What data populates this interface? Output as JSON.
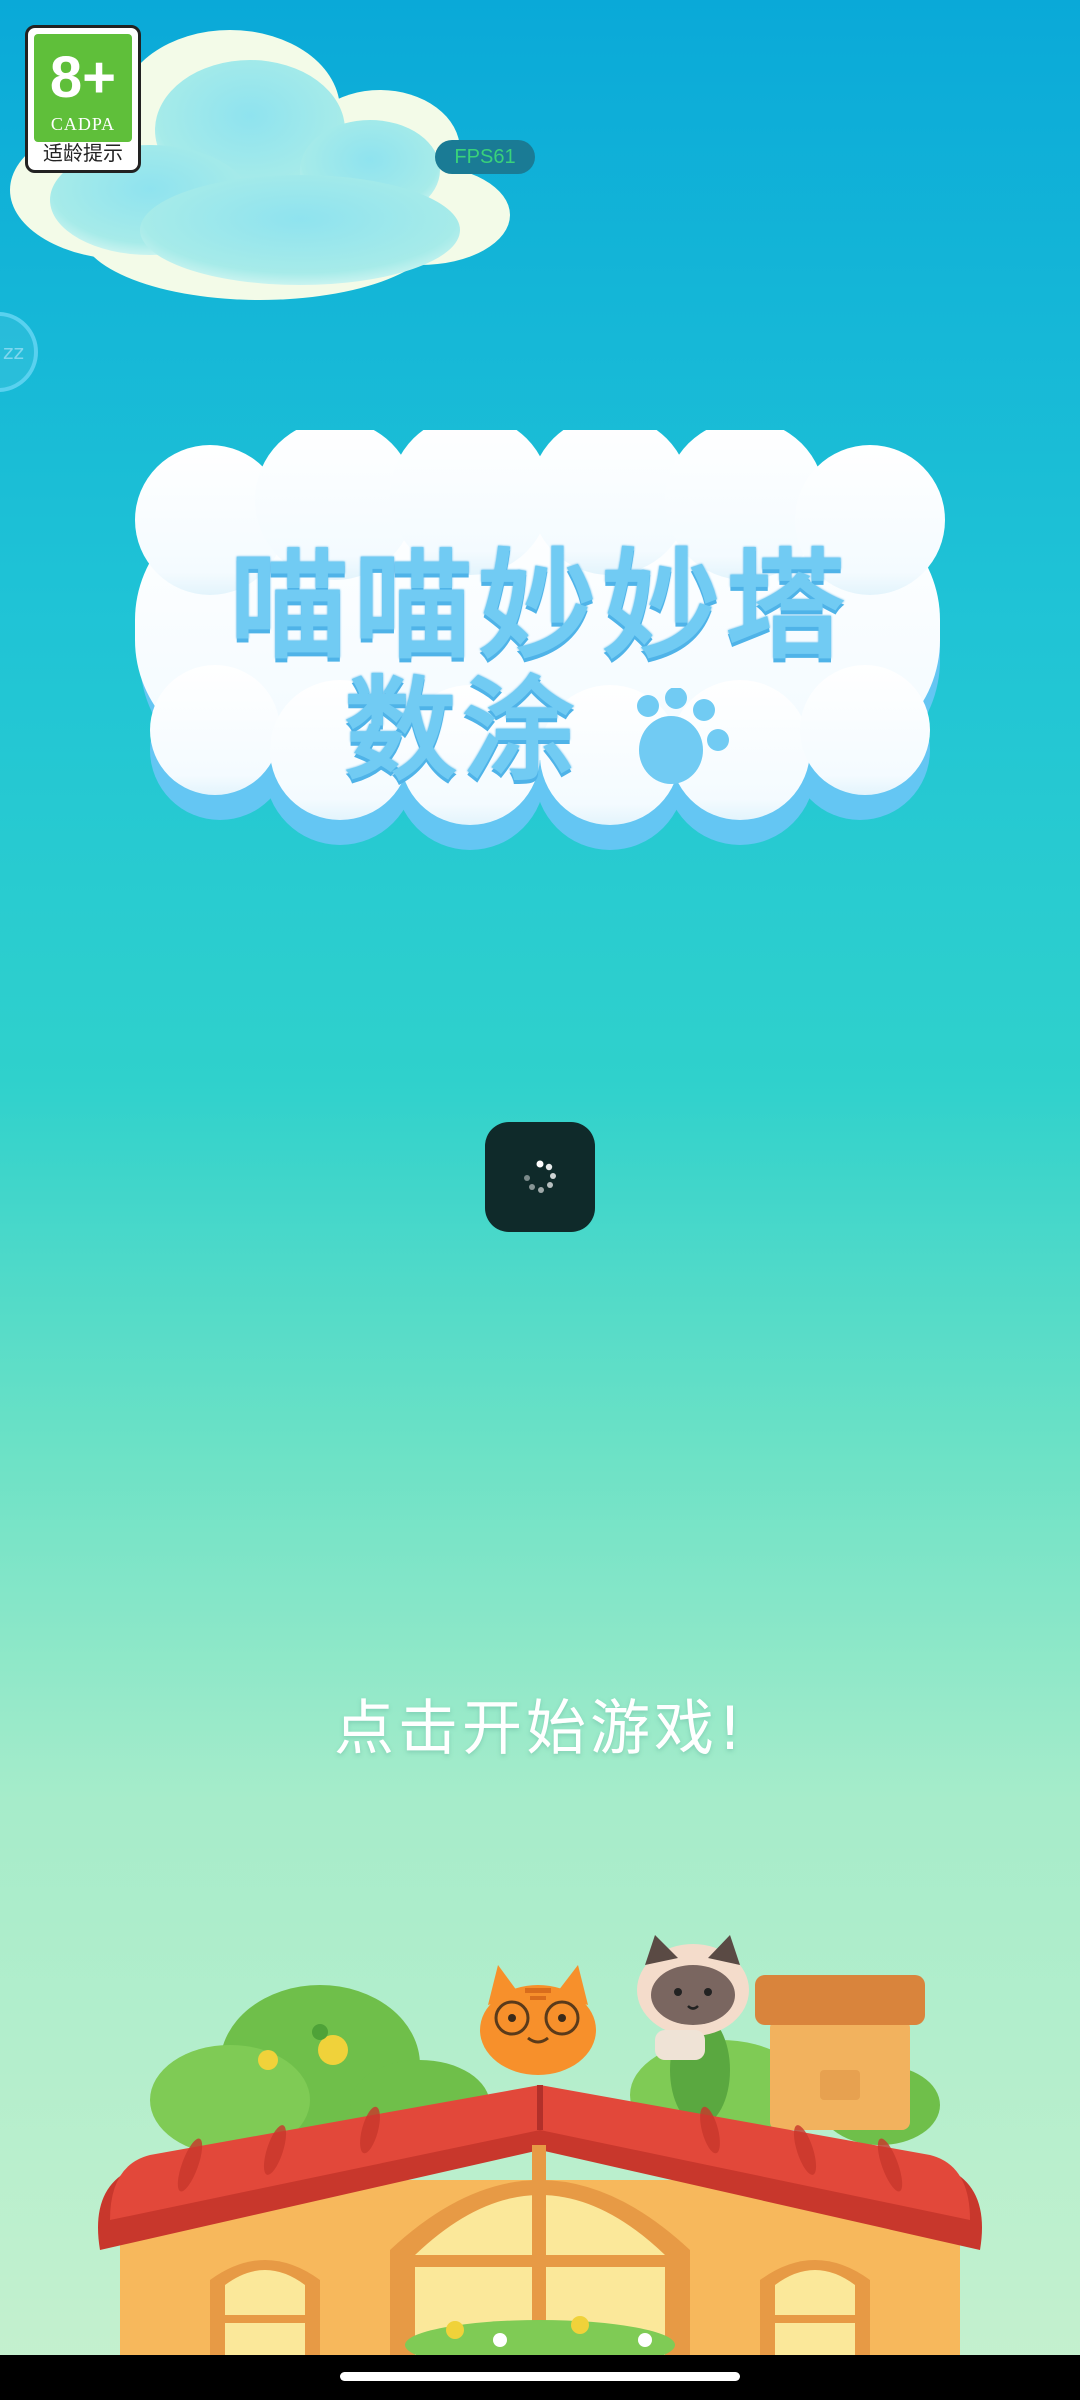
{
  "age_rating": {
    "age": "8+",
    "org": "CADPA",
    "tip": "适龄提示"
  },
  "fps": "FPS61",
  "sleep_button": "zz",
  "title": {
    "line1": "喵喵妙妙塔",
    "line2": "数涂"
  },
  "loading": true,
  "start_prompt": "点击开始游戏!",
  "colors": {
    "sky_top": "#0aa9d8",
    "sky_bottom": "#c6f1cf",
    "title_blue": "#71cbf3",
    "roof_red": "#e2483a",
    "wall_orange": "#f7b85c"
  }
}
